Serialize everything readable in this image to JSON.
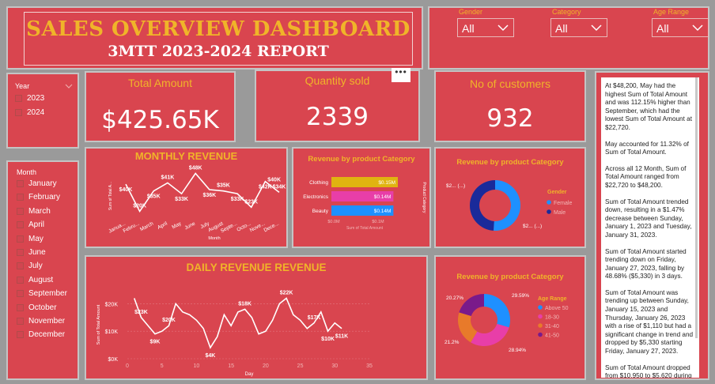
{
  "header": {
    "title": "SALES  OVERVIEW DASHBOARD",
    "subtitle": "3MTT 2023-2024 REPORT"
  },
  "filters": [
    {
      "label": "Gender",
      "value": "All"
    },
    {
      "label": "Category",
      "value": "All"
    },
    {
      "label": "Age Range",
      "value": "All"
    }
  ],
  "year_slicer": {
    "title": "Year",
    "items": [
      "2023",
      "2024"
    ]
  },
  "month_slicer": {
    "title": "Month",
    "items": [
      "January",
      "February",
      "March",
      "April",
      "May",
      "June",
      "July",
      "August",
      "September",
      "October",
      "November",
      "December"
    ]
  },
  "kpis": [
    {
      "title": "Total Amount",
      "value": "$425.65K"
    },
    {
      "title": "Quantity sold",
      "value": "2339"
    },
    {
      "title": "No of customers",
      "value": "932"
    }
  ],
  "more_button": "•••",
  "colors": {
    "panel": "#d9454f",
    "gold": "#f0b429",
    "clothing": "#e0b410",
    "electronics": "#e83ea8",
    "beauty": "#1e90ff",
    "female": "#1e90ff",
    "male": "#1a2a9a",
    "age_1": "#1e90ff",
    "age_2": "#e83ea8",
    "age_3": "#e87a2a",
    "age_4": "#7a1a8a"
  },
  "chart_data": [
    {
      "type": "line",
      "title": "MONTHLY REVENUE",
      "xlabel": "Month",
      "ylabel": "Sum of Total A...",
      "categories": [
        "January",
        "February",
        "March",
        "April",
        "May",
        "June",
        "July",
        "August",
        "September",
        "October",
        "November",
        "December"
      ],
      "tick_labels": [
        "Janua...",
        "Febru...",
        "March",
        "April",
        "May",
        "June",
        "July",
        "August",
        "Septe...",
        "Octo...",
        "Nove...",
        "Dece..."
      ],
      "values": [
        40,
        20,
        35,
        41,
        33,
        48,
        36,
        35,
        33,
        23,
        42,
        34
      ],
      "data_labels": [
        "$40K",
        "$20K",
        "$35K",
        "$41K",
        "$33K",
        "$48K",
        "$36K",
        "$35K",
        "$33K",
        "$23K",
        "$42K",
        "$34K"
      ],
      "extra_label": "$40K",
      "ylim": [
        15,
        50
      ]
    },
    {
      "type": "bar",
      "orientation": "horizontal",
      "title": "Revenue by product Category",
      "xlabel": "Sum of Total Amount",
      "ylabel": "Product Category",
      "categories": [
        "Clothing",
        "Electronics",
        "Beauty"
      ],
      "values": [
        0.15,
        0.14,
        0.14
      ],
      "data_labels": [
        "$0.15M",
        "$0.14M",
        "$0.14M"
      ],
      "x_ticks": [
        "$0.0M",
        "$0.1M"
      ],
      "xlim": [
        0,
        0.15
      ]
    },
    {
      "type": "pie",
      "title": "Revenue by product Category",
      "legend_title": "Gender",
      "categories": [
        "Female",
        "Male"
      ],
      "values": [
        51,
        49
      ],
      "data_labels": [
        "$2... (...)",
        "$2... (...)"
      ]
    },
    {
      "type": "line",
      "title": "DAILY REVENUE REVENUE",
      "xlabel": "Day",
      "ylabel": "Sum of Total Amount",
      "x": [
        1,
        2,
        3,
        4,
        5,
        6,
        7,
        8,
        9,
        10,
        11,
        12,
        13,
        14,
        15,
        16,
        17,
        18,
        19,
        20,
        21,
        22,
        23,
        24,
        25,
        26,
        27,
        28,
        29,
        30,
        31
      ],
      "values": [
        22,
        15,
        12,
        9,
        10,
        12,
        20,
        17,
        16,
        14,
        11,
        4,
        8,
        16,
        12,
        17,
        18,
        15,
        9,
        10,
        14,
        20,
        22,
        16,
        14,
        11,
        13,
        17,
        10,
        13,
        11
      ],
      "data_labels": {
        "2": "$23K",
        "4": "$9K",
        "6": "$20K",
        "12": "$4K",
        "17": "$18K",
        "23": "$22K",
        "27": "$17K",
        "29": "$10K",
        "31": "$11K"
      },
      "y_ticks": [
        "$0K",
        "$10K",
        "$20K"
      ],
      "x_ticks": [
        "0",
        "5",
        "10",
        "15",
        "20",
        "25",
        "30",
        "35"
      ],
      "ylim": [
        0,
        25
      ],
      "xlim": [
        0,
        35
      ]
    },
    {
      "type": "pie",
      "title": "Revenue by product Category",
      "legend_title": "Age Range",
      "categories": [
        "Above 50",
        "18-30",
        "31-40",
        "41-50"
      ],
      "values": [
        29.59,
        28.94,
        21.2,
        20.27
      ],
      "data_labels": [
        "29.59%",
        "28.94%",
        "21.2%",
        "20.27%"
      ]
    }
  ],
  "narrative": [
    "At $48,200, May had the highest Sum of Total Amount and was 112.15% higher than September, which had the lowest Sum of Total Amount at $22,720.",
    "May accounted for 11.32% of Sum of Total Amount.",
    "Across all 12 Month, Sum of Total Amount ranged from $22,720 to $48,200.",
    "Sum of Total Amount trended down, resulting in a $1.47% decrease between Sunday, January 1, 2023 and Tuesday, January 31, 2023.",
    "Sum of Total Amount started trending down on Friday, January 27, 2023, falling by 48.68% ($5,330) in 3 days.",
    "Sum of Total Amount was trending up between Sunday, January 15, 2023 and Thursday, January 26, 2023 with a rise of $1,110 but had a significant change in trend and dropped by $5,330 starting Friday, January 27, 2023.",
    "Sum of Total Amount dropped from $10,950 to $5,620 during"
  ]
}
